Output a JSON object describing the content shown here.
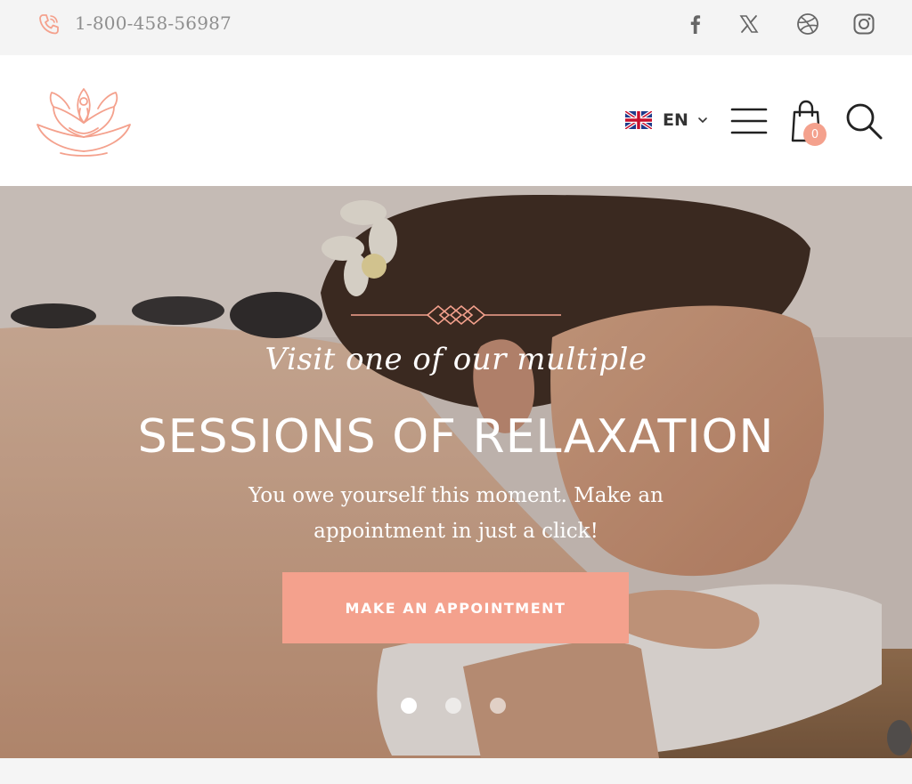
{
  "topbar": {
    "phone": "1-800-458-56987",
    "social": [
      {
        "name": "facebook-icon"
      },
      {
        "name": "x-twitter-icon"
      },
      {
        "name": "dribbble-icon"
      },
      {
        "name": "instagram-icon"
      }
    ]
  },
  "header": {
    "language": "EN",
    "cart_count": "0"
  },
  "hero": {
    "script_text": "Visit one of our multiple",
    "title": "SESSIONS OF RELAXATION",
    "subtitle": "You owe yourself this moment. Make an appointment in just a click!",
    "cta_label": "MAKE AN APPOINTMENT",
    "slides": 3,
    "active_slide": 1
  },
  "colors": {
    "accent": "#f4a18d",
    "topbar_bg": "#f4f4f4",
    "text_muted": "#8f8f8f"
  }
}
